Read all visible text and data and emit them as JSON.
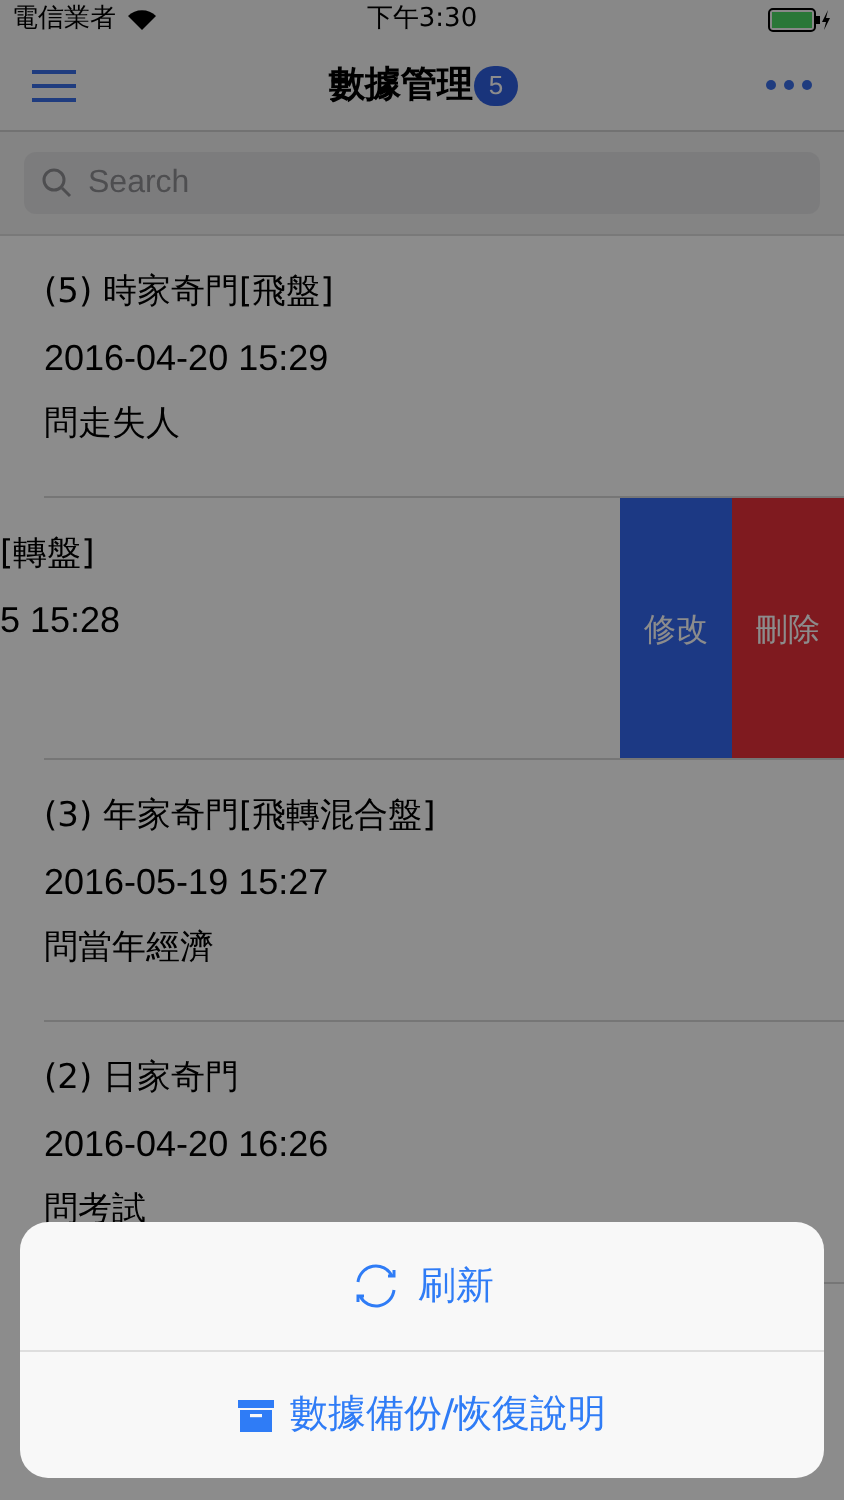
{
  "status_bar": {
    "carrier": "電信業者",
    "time": "下午3:30"
  },
  "nav": {
    "title": "數據管理",
    "badge": "5"
  },
  "search": {
    "placeholder": "Search"
  },
  "records": [
    {
      "title": "(5) 時家奇門[飛盤]",
      "date": "2016-04-20 15:29",
      "question": "問走失人",
      "swiped": false
    },
    {
      "title": "[轉盤]",
      "date": "5 15:28",
      "swiped": true,
      "actions": [
        {
          "label": "修改",
          "kind": "edit"
        },
        {
          "label": "刪除",
          "kind": "delete"
        }
      ]
    },
    {
      "title": "(3) 年家奇門[飛轉混合盤]",
      "date": "2016-05-19 15:27",
      "question": "問當年經濟",
      "swiped": false
    },
    {
      "title": "(2) 日家奇門",
      "date": "2016-04-20 16:26",
      "question": "問考試",
      "swiped": false
    }
  ],
  "action_sheet": [
    {
      "label": "刷新",
      "kind": "refresh"
    },
    {
      "label": "數據備份/恢復說明",
      "kind": "archive"
    }
  ]
}
